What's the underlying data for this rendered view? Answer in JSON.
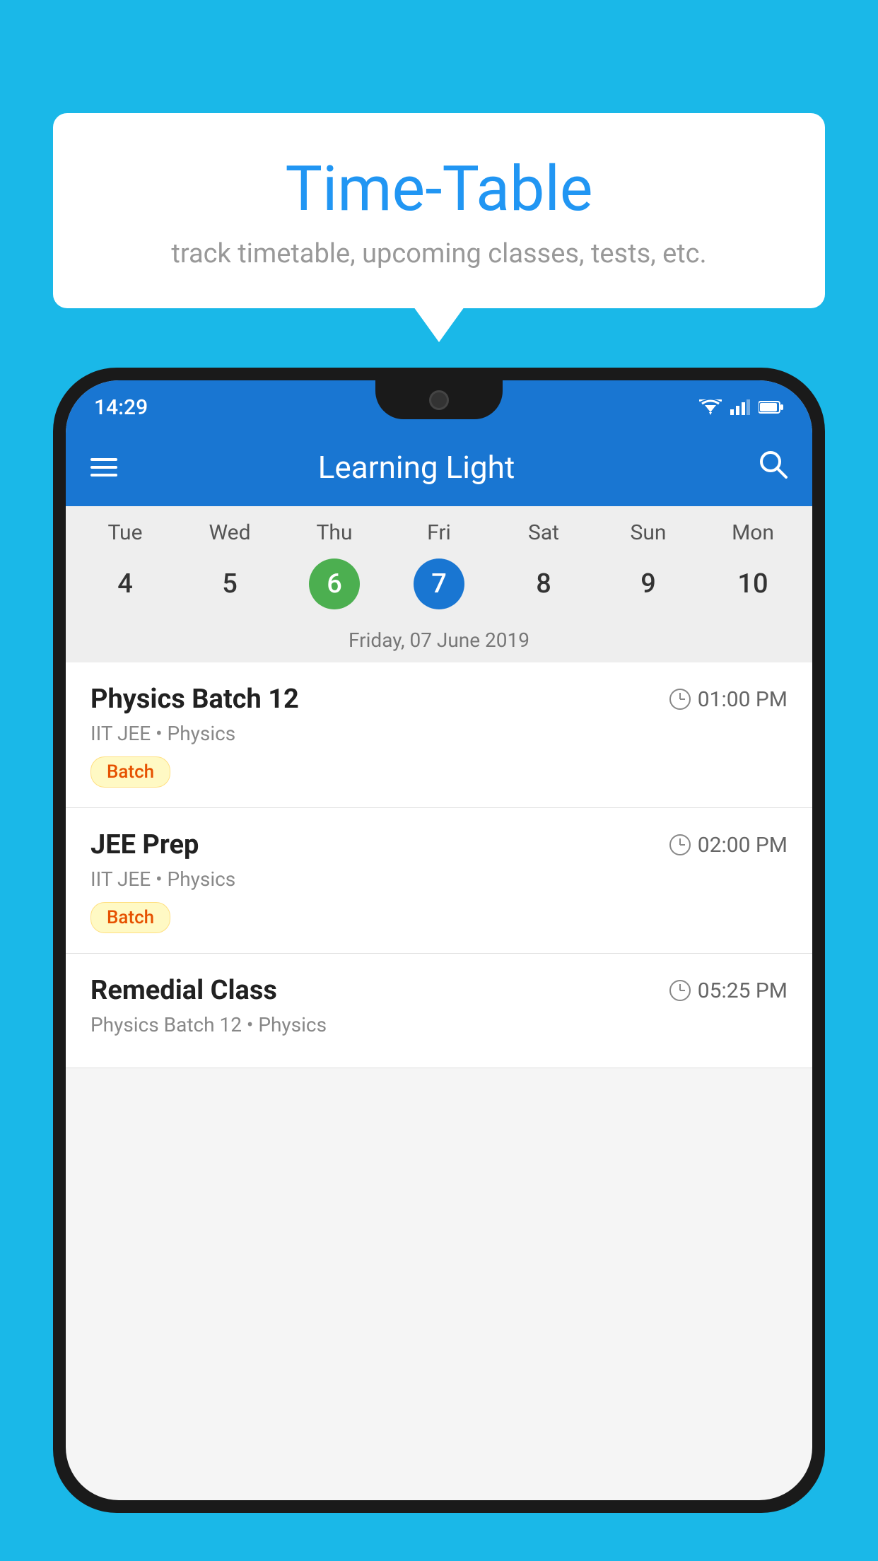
{
  "page": {
    "background_color": "#1ab8e8"
  },
  "bubble": {
    "title": "Time-Table",
    "subtitle": "track timetable, upcoming classes, tests, etc."
  },
  "phone": {
    "status_bar": {
      "time": "14:29"
    },
    "app_bar": {
      "title": "Learning Light"
    },
    "calendar": {
      "day_names": [
        "Tue",
        "Wed",
        "Thu",
        "Fri",
        "Sat",
        "Sun",
        "Mon"
      ],
      "dates": [
        "4",
        "5",
        "6",
        "7",
        "8",
        "9",
        "10"
      ],
      "today_index": 2,
      "selected_index": 3,
      "selected_label": "Friday, 07 June 2019"
    },
    "classes": [
      {
        "name": "Physics Batch 12",
        "time": "01:00 PM",
        "subject": "IIT JEE • Physics",
        "badge": "Batch"
      },
      {
        "name": "JEE Prep",
        "time": "02:00 PM",
        "subject": "IIT JEE • Physics",
        "badge": "Batch"
      },
      {
        "name": "Remedial Class",
        "time": "05:25 PM",
        "subject": "Physics Batch 12 • Physics",
        "badge": null
      }
    ]
  }
}
